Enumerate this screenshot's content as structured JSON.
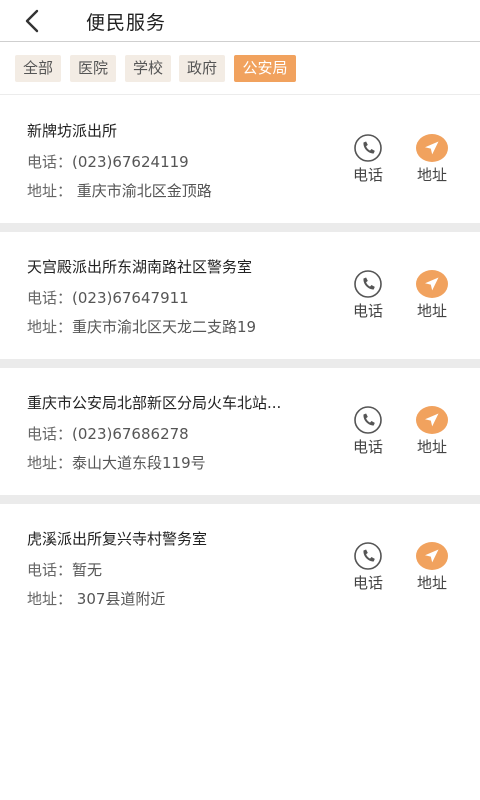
{
  "header": {
    "title": "便民服务",
    "back_icon": "back-arrow-icon"
  },
  "tabs": [
    {
      "label": "全部",
      "active": false
    },
    {
      "label": "医院",
      "active": false
    },
    {
      "label": "学校",
      "active": false
    },
    {
      "label": "政府",
      "active": false
    },
    {
      "label": "公安局",
      "active": true
    }
  ],
  "colors": {
    "accent": "#f1a25e",
    "tab_bg": "#f3ece4",
    "separator": "#ebebeb"
  },
  "list": {
    "items": [
      {
        "name": "新牌坊派出所",
        "phone_label": "电话：",
        "phone": "(023)67624119",
        "address_label": "地址：",
        "address": " 重庆市渝北区金顶路",
        "call_label": "电话",
        "nav_label": "地址"
      },
      {
        "name": "天宫殿派出所东湖南路社区警务室",
        "phone_label": "电话：",
        "phone": "(023)67647911",
        "address_label": "地址：",
        "address": "重庆市渝北区天龙二支路19",
        "call_label": "电话",
        "nav_label": "地址"
      },
      {
        "name": "重庆市公安局北部新区分局火车北站...",
        "phone_label": "电话：",
        "phone": "(023)67686278",
        "address_label": "地址：",
        "address": "泰山大道东段119号",
        "call_label": "电话",
        "nav_label": "地址"
      },
      {
        "name": "虎溪派出所复兴寺村警务室",
        "phone_label": "电话：",
        "phone": "暂无",
        "address_label": "地址：",
        "address": " 307县道附近",
        "call_label": "电话",
        "nav_label": "地址"
      }
    ]
  }
}
